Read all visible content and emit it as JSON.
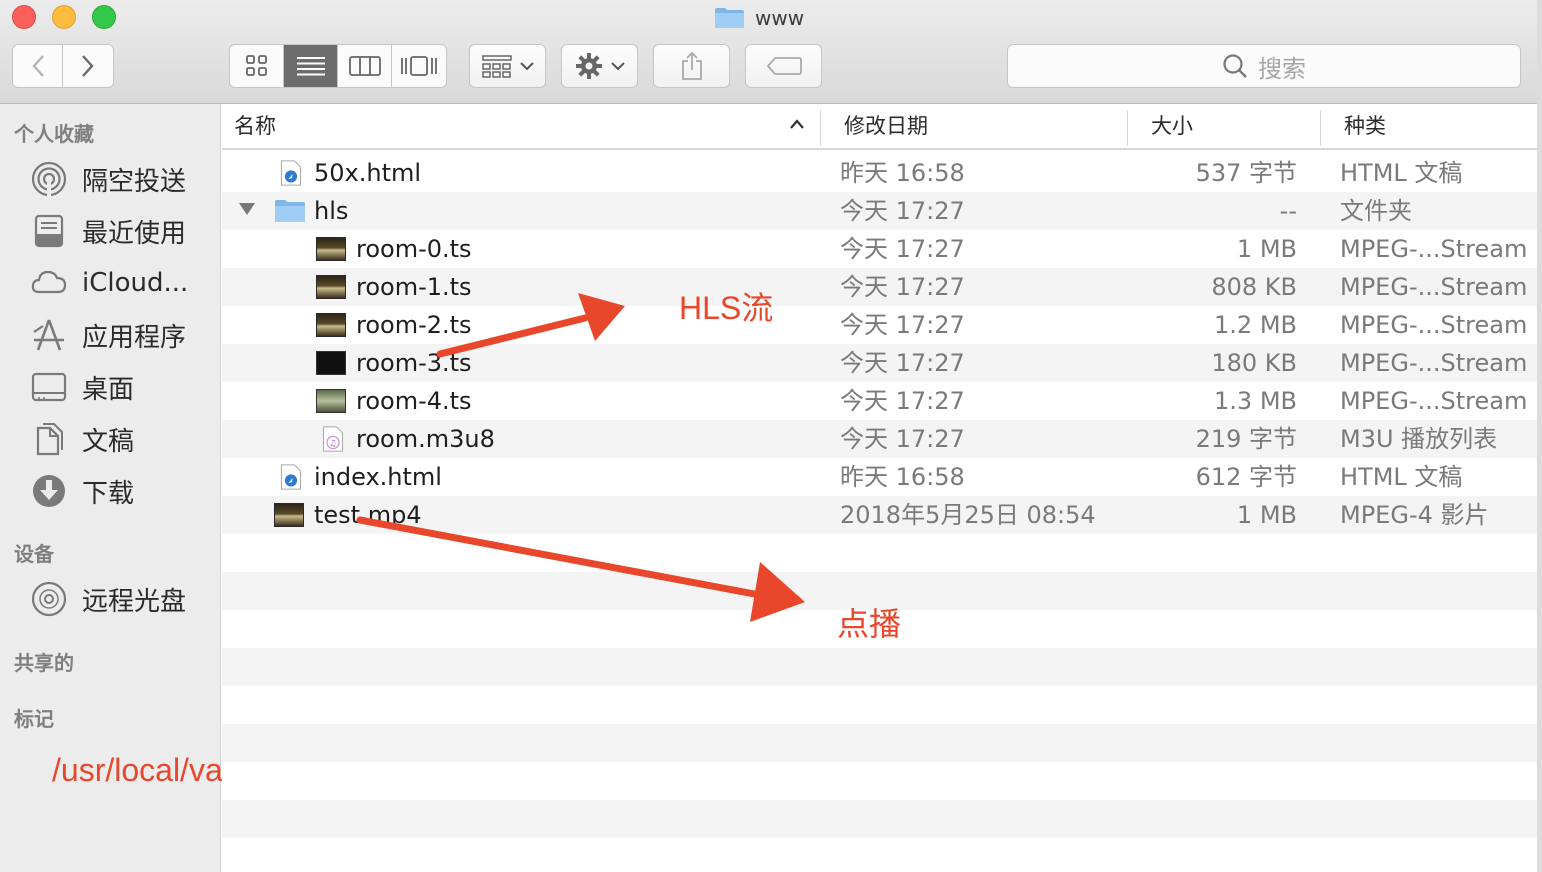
{
  "window": {
    "title": "www"
  },
  "toolbar": {
    "back_icon": "chevron-left-icon",
    "forward_icon": "chevron-right-icon",
    "view_modes": [
      "icon-view",
      "list-view",
      "column-view",
      "cover-flow-view"
    ],
    "active_view": "list-view",
    "search_placeholder": "搜索"
  },
  "sidebar": {
    "sections": [
      {
        "title": "个人收藏",
        "items": [
          {
            "label": "隔空投送",
            "icon": "airdrop-icon"
          },
          {
            "label": "最近使用",
            "icon": "recents-icon"
          },
          {
            "label": "iCloud...",
            "icon": "cloud-icon"
          },
          {
            "label": "应用程序",
            "icon": "applications-icon"
          },
          {
            "label": "桌面",
            "icon": "desktop-icon"
          },
          {
            "label": "文稿",
            "icon": "documents-icon"
          },
          {
            "label": "下载",
            "icon": "downloads-icon"
          }
        ]
      },
      {
        "title": "设备",
        "items": [
          {
            "label": "远程光盘",
            "icon": "disc-icon"
          }
        ]
      },
      {
        "title": "共享的",
        "items": []
      },
      {
        "title": "标记",
        "items": []
      }
    ]
  },
  "columns": {
    "name": "名称",
    "date": "修改日期",
    "size": "大小",
    "kind": "种类"
  },
  "files": [
    {
      "name": "50x.html",
      "date": "昨天 16:58",
      "size": "537 字节",
      "kind": "HTML 文稿",
      "icon": "html-file-icon"
    },
    {
      "name": "hls",
      "date": "今天 17:27",
      "size": "--",
      "kind": "文件夹",
      "icon": "folder-icon"
    },
    {
      "name": "room-0.ts",
      "date": "今天 17:27",
      "size": "1 MB",
      "kind": "MPEG-...Stream",
      "icon": "video-thumbnail-icon"
    },
    {
      "name": "room-1.ts",
      "date": "今天 17:27",
      "size": "808 KB",
      "kind": "MPEG-...Stream",
      "icon": "video-thumbnail-icon"
    },
    {
      "name": "room-2.ts",
      "date": "今天 17:27",
      "size": "1.2 MB",
      "kind": "MPEG-...Stream",
      "icon": "video-thumbnail-icon"
    },
    {
      "name": "room-3.ts",
      "date": "今天 17:27",
      "size": "180 KB",
      "kind": "MPEG-...Stream",
      "icon": "video-thumbnail-icon"
    },
    {
      "name": "room-4.ts",
      "date": "今天 17:27",
      "size": "1.3 MB",
      "kind": "MPEG-...Stream",
      "icon": "video-thumbnail-icon"
    },
    {
      "name": "room.m3u8",
      "date": "今天 17:27",
      "size": "219 字节",
      "kind": "M3U 播放列表",
      "icon": "playlist-file-icon"
    },
    {
      "name": "index.html",
      "date": "昨天 16:58",
      "size": "612 字节",
      "kind": "HTML 文稿",
      "icon": "html-file-icon"
    },
    {
      "name": "test.mp4",
      "date": "2018年5月25日 08:54",
      "size": "1 MB",
      "kind": "MPEG-4 影片",
      "icon": "video-thumbnail-icon"
    }
  ],
  "annotations": {
    "hls": "HLS流",
    "vod": "点播",
    "path": "/usr/local/var/www",
    "color": "#e8472b"
  }
}
